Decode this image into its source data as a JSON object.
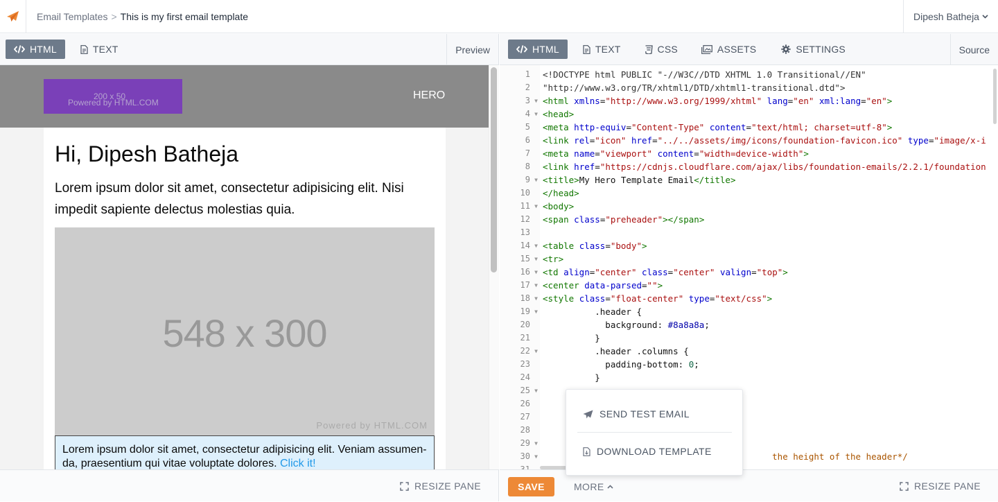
{
  "header": {
    "breadcrumb_parent": "Email Templates",
    "breadcrumb_separator": ">",
    "breadcrumb_current": "This is my first email template",
    "user_name": "Dipesh Batheja"
  },
  "left_tabs": {
    "html": "HTML",
    "text": "TEXT",
    "right_label": "Preview"
  },
  "right_tabs": {
    "html": "HTML",
    "text": "TEXT",
    "css": "CSS",
    "assets": "ASSETS",
    "settings": "SETTINGS",
    "right_label": "Source"
  },
  "preview": {
    "logo_dimension": "200 x 50",
    "logo_powered": "Powered by HTML.COM",
    "hero_label": "HERO",
    "greeting": "Hi, Dipesh Batheja",
    "paragraph": "Lorem ipsum dolor sit amet, consectetur adipisicing elit. Nisi impedit sapiente delectus molestias quia.",
    "image_dimension": "548 x 300",
    "image_powered": "Powered by HTML.COM",
    "callout_line1": "Lorem ipsum dolor sit amet, consectetur adipisicing elit. Veniam assumen-",
    "callout_line2": "da, praesentium qui vitae voluptate dolores. ",
    "callout_link": "Click it!"
  },
  "footer": {
    "resize_left": "RESIZE PANE",
    "resize_right": "RESIZE PANE",
    "save": "SAVE",
    "more": "MORE"
  },
  "menu": {
    "send_test": "SEND TEST EMAIL",
    "download": "DOWNLOAD TEMPLATE"
  },
  "code_lines": [
    {
      "n": "1",
      "fold": false,
      "parts": [
        [
          "doc",
          "<!DOCTYPE html PUBLIC \"-//W3C//DTD XHTML 1.0 Transitional//EN\""
        ]
      ]
    },
    {
      "n": "2",
      "fold": false,
      "parts": [
        [
          "doc",
          "\"http://www.w3.org/TR/xhtml1/DTD/xhtml1-transitional.dtd\">"
        ]
      ]
    },
    {
      "n": "3",
      "fold": true,
      "parts": [
        [
          "tag",
          "<html"
        ],
        [
          "plain",
          " "
        ],
        [
          "attr",
          "xmlns"
        ],
        [
          "plain",
          "="
        ],
        [
          "str",
          "\"http://www.w3.org/1999/xhtml\""
        ],
        [
          "plain",
          " "
        ],
        [
          "attr",
          "lang"
        ],
        [
          "plain",
          "="
        ],
        [
          "str",
          "\"en\""
        ],
        [
          "plain",
          " "
        ],
        [
          "attr",
          "xml:lang"
        ],
        [
          "plain",
          "="
        ],
        [
          "str",
          "\"en\""
        ],
        [
          "tag",
          ">"
        ]
      ]
    },
    {
      "n": "4",
      "fold": true,
      "parts": [
        [
          "tag",
          "<head>"
        ]
      ]
    },
    {
      "n": "5",
      "fold": false,
      "parts": [
        [
          "tag",
          "<meta"
        ],
        [
          "plain",
          " "
        ],
        [
          "attr",
          "http-equiv"
        ],
        [
          "plain",
          "="
        ],
        [
          "str",
          "\"Content-Type\""
        ],
        [
          "plain",
          " "
        ],
        [
          "attr",
          "content"
        ],
        [
          "plain",
          "="
        ],
        [
          "str",
          "\"text/html; charset=utf-8\""
        ],
        [
          "tag",
          ">"
        ]
      ]
    },
    {
      "n": "6",
      "fold": false,
      "parts": [
        [
          "tag",
          "<link"
        ],
        [
          "plain",
          " "
        ],
        [
          "attr",
          "rel"
        ],
        [
          "plain",
          "="
        ],
        [
          "str",
          "\"icon\""
        ],
        [
          "plain",
          " "
        ],
        [
          "attr",
          "href"
        ],
        [
          "plain",
          "="
        ],
        [
          "str",
          "\"../../assets/img/icons/foundation-favicon.ico\""
        ],
        [
          "plain",
          " "
        ],
        [
          "attr",
          "type"
        ],
        [
          "plain",
          "="
        ],
        [
          "str",
          "\"image/x-i"
        ]
      ]
    },
    {
      "n": "7",
      "fold": false,
      "parts": [
        [
          "tag",
          "<meta"
        ],
        [
          "plain",
          " "
        ],
        [
          "attr",
          "name"
        ],
        [
          "plain",
          "="
        ],
        [
          "str",
          "\"viewport\""
        ],
        [
          "plain",
          " "
        ],
        [
          "attr",
          "content"
        ],
        [
          "plain",
          "="
        ],
        [
          "str",
          "\"width=device-width\""
        ],
        [
          "tag",
          ">"
        ]
      ]
    },
    {
      "n": "8",
      "fold": false,
      "parts": [
        [
          "tag",
          "<link"
        ],
        [
          "plain",
          " "
        ],
        [
          "attr",
          "href"
        ],
        [
          "plain",
          "="
        ],
        [
          "str",
          "\"https://cdnjs.cloudflare.com/ajax/libs/foundation-emails/2.2.1/foundation"
        ]
      ]
    },
    {
      "n": "9",
      "fold": true,
      "parts": [
        [
          "tag",
          "<title>"
        ],
        [
          "plain",
          "My Hero Template Email"
        ],
        [
          "tag",
          "</title>"
        ]
      ]
    },
    {
      "n": "10",
      "fold": false,
      "parts": [
        [
          "tag",
          "</head>"
        ]
      ]
    },
    {
      "n": "11",
      "fold": true,
      "parts": [
        [
          "tag",
          "<body>"
        ]
      ]
    },
    {
      "n": "12",
      "fold": false,
      "parts": [
        [
          "tag",
          "<span"
        ],
        [
          "plain",
          " "
        ],
        [
          "attr",
          "class"
        ],
        [
          "plain",
          "="
        ],
        [
          "str",
          "\"preheader\""
        ],
        [
          "tag",
          "></span>"
        ]
      ]
    },
    {
      "n": "13",
      "fold": false,
      "parts": []
    },
    {
      "n": "14",
      "fold": true,
      "parts": [
        [
          "tag",
          "<table"
        ],
        [
          "plain",
          " "
        ],
        [
          "attr",
          "class"
        ],
        [
          "plain",
          "="
        ],
        [
          "str",
          "\"body\""
        ],
        [
          "tag",
          ">"
        ]
      ]
    },
    {
      "n": "15",
      "fold": true,
      "parts": [
        [
          "tag",
          "<tr>"
        ]
      ]
    },
    {
      "n": "16",
      "fold": true,
      "parts": [
        [
          "tag",
          "<td"
        ],
        [
          "plain",
          " "
        ],
        [
          "attr",
          "align"
        ],
        [
          "plain",
          "="
        ],
        [
          "str",
          "\"center\""
        ],
        [
          "plain",
          " "
        ],
        [
          "attr",
          "class"
        ],
        [
          "plain",
          "="
        ],
        [
          "str",
          "\"center\""
        ],
        [
          "plain",
          " "
        ],
        [
          "attr",
          "valign"
        ],
        [
          "plain",
          "="
        ],
        [
          "str",
          "\"top\""
        ],
        [
          "tag",
          ">"
        ]
      ]
    },
    {
      "n": "17",
      "fold": true,
      "parts": [
        [
          "tag",
          "<center"
        ],
        [
          "plain",
          " "
        ],
        [
          "attr",
          "data-parsed"
        ],
        [
          "plain",
          "="
        ],
        [
          "str",
          "\"\""
        ],
        [
          "tag",
          ">"
        ]
      ]
    },
    {
      "n": "18",
      "fold": true,
      "parts": [
        [
          "tag",
          "<style"
        ],
        [
          "plain",
          " "
        ],
        [
          "attr",
          "class"
        ],
        [
          "plain",
          "="
        ],
        [
          "str",
          "\"float-center\""
        ],
        [
          "plain",
          " "
        ],
        [
          "attr",
          "type"
        ],
        [
          "plain",
          "="
        ],
        [
          "str",
          "\"text/css\""
        ],
        [
          "tag",
          ">"
        ]
      ]
    },
    {
      "n": "19",
      "fold": true,
      "parts": [
        [
          "plain",
          "          .header {"
        ]
      ]
    },
    {
      "n": "20",
      "fold": false,
      "parts": [
        [
          "plain",
          "            background: "
        ],
        [
          "hex",
          "#8a8a8a"
        ],
        [
          "plain",
          ";"
        ]
      ]
    },
    {
      "n": "21",
      "fold": false,
      "parts": [
        [
          "plain",
          "          }"
        ]
      ]
    },
    {
      "n": "22",
      "fold": true,
      "parts": [
        [
          "plain",
          "          .header .columns {"
        ]
      ]
    },
    {
      "n": "23",
      "fold": false,
      "parts": [
        [
          "plain",
          "            padding-bottom: "
        ],
        [
          "num",
          "0"
        ],
        [
          "plain",
          ";"
        ]
      ]
    },
    {
      "n": "24",
      "fold": false,
      "parts": [
        [
          "plain",
          "          }"
        ]
      ]
    },
    {
      "n": "25",
      "fold": true,
      "parts": []
    },
    {
      "n": "26",
      "fold": false,
      "parts": []
    },
    {
      "n": "27",
      "fold": false,
      "parts": []
    },
    {
      "n": "28",
      "fold": false,
      "parts": []
    },
    {
      "n": "29",
      "fold": true,
      "parts": []
    },
    {
      "n": "30",
      "fold": true,
      "parts": [
        [
          "plain",
          "                                            "
        ],
        [
          "com",
          "the height of the header*/"
        ]
      ]
    },
    {
      "n": "31",
      "fold": false,
      "parts": []
    }
  ],
  "colors": {
    "accent_orange": "#ed8936",
    "active_tab": "#6d7a8a",
    "hero_gray": "#8a8a8a",
    "logo_purple": "#7a40b8",
    "callout_bg": "#def0fc",
    "link_blue": "#2199e8"
  },
  "icons": {
    "app_logo": "paper-plane-icon",
    "code": "code-icon",
    "text": "document-icon",
    "css": "css3-icon",
    "assets": "image-icon",
    "settings": "gear-icon",
    "resize": "expand-icon",
    "send": "paper-plane-icon",
    "download": "file-download-icon"
  }
}
